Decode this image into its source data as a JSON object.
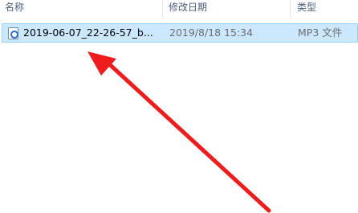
{
  "columns": {
    "name": "名称",
    "date_modified": "修改日期",
    "type": "类型"
  },
  "files": [
    {
      "name": "2019-06-07_22-26-57_b...",
      "date_modified": "2019/8/18 15:34",
      "type": "MP3 文件",
      "icon": "audio-file-icon",
      "selected": true
    }
  ],
  "colors": {
    "selection_bg": "#cce8ff",
    "selection_border": "#99d1ff",
    "header_text": "#4c607a",
    "annotation_arrow": "#ee1c1c"
  },
  "annotation": {
    "type": "arrow",
    "icon": "red-arrow-icon",
    "points_to": "file-row"
  }
}
